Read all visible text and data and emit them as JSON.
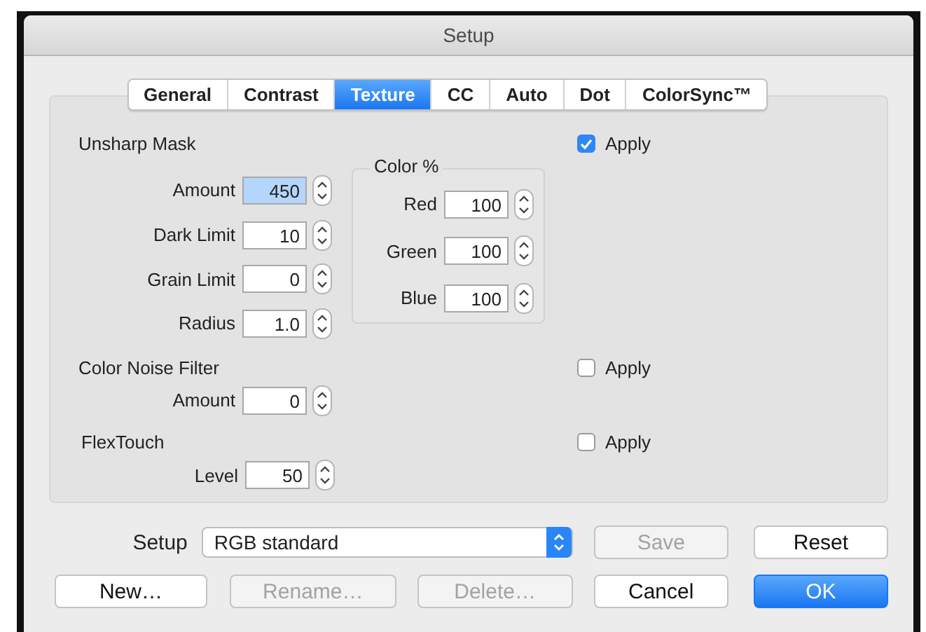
{
  "window": {
    "title": "Setup"
  },
  "tabs": [
    {
      "label": "General",
      "selected": false
    },
    {
      "label": "Contrast",
      "selected": false
    },
    {
      "label": "Texture",
      "selected": true
    },
    {
      "label": "CC",
      "selected": false
    },
    {
      "label": "Auto",
      "selected": false
    },
    {
      "label": "Dot",
      "selected": false
    },
    {
      "label": "ColorSync™",
      "selected": false
    }
  ],
  "sections": [
    {
      "title": "Unsharp Mask",
      "apply": {
        "label": "Apply",
        "checked": true
      },
      "fields": [
        {
          "label": "Amount",
          "value": "450",
          "selected": true
        },
        {
          "label": "Dark Limit",
          "value": "10",
          "selected": false
        },
        {
          "label": "Grain Limit",
          "value": "0",
          "selected": false
        },
        {
          "label": "Radius",
          "value": "1.0",
          "selected": false
        }
      ],
      "color_group": {
        "title": "Color %",
        "fields": [
          {
            "label": "Red",
            "value": "100",
            "selected": false
          },
          {
            "label": "Green",
            "value": "100",
            "selected": false
          },
          {
            "label": "Blue",
            "value": "100",
            "selected": false
          }
        ]
      }
    },
    {
      "title": "Color Noise Filter",
      "apply": {
        "label": "Apply",
        "checked": false
      },
      "fields": [
        {
          "label": "Amount",
          "value": "0",
          "selected": false
        }
      ]
    },
    {
      "title": "FlexTouch",
      "apply": {
        "label": "Apply",
        "checked": false
      },
      "fields": [
        {
          "label": "Level",
          "value": "50",
          "selected": false
        }
      ]
    }
  ],
  "setup": {
    "label": "Setup",
    "value": "RGB standard"
  },
  "buttons_row_1": [
    {
      "label": "Save",
      "disabled": true,
      "default": false
    },
    {
      "label": "Reset",
      "disabled": false,
      "default": false
    }
  ],
  "buttons_row_2": [
    {
      "label": "New…",
      "disabled": false,
      "default": false
    },
    {
      "label": "Rename…",
      "disabled": true,
      "default": false
    },
    {
      "label": "Delete…",
      "disabled": true,
      "default": false
    },
    {
      "label": "Cancel",
      "disabled": false,
      "default": false
    },
    {
      "label": "OK",
      "disabled": false,
      "default": true
    }
  ]
}
